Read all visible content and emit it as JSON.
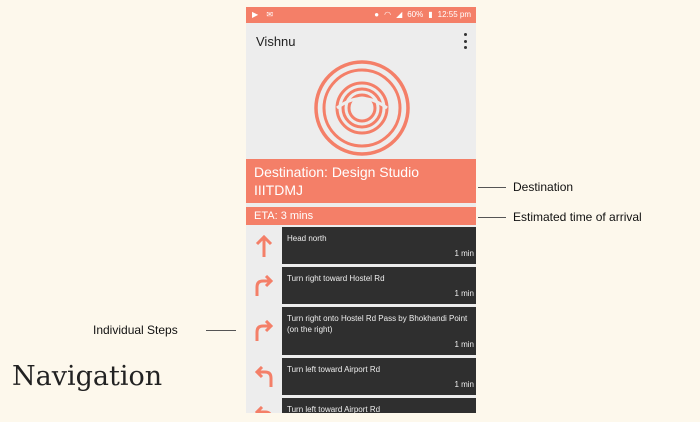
{
  "status_bar": {
    "left_icons": [
      "play-icon",
      "notification-icon"
    ],
    "battery": "60%",
    "time": "12:55 pm"
  },
  "app_bar": {
    "title": "Vishnu",
    "menu_icon": "more-vert-icon"
  },
  "destination": {
    "text": "Destination: Design Studio IIITDMJ"
  },
  "eta": {
    "text": "ETA: 3 mins"
  },
  "steps": [
    {
      "instruction": "Head north",
      "duration": "1 min",
      "icon": "arrow-up-icon"
    },
    {
      "instruction": "Turn right toward Hostel Rd",
      "duration": "1 min",
      "icon": "turn-right-icon"
    },
    {
      "instruction": "Turn right onto Hostel Rd Pass by Bhokhandi Point (on the right)",
      "duration": "1 min",
      "icon": "turn-right-icon"
    },
    {
      "instruction": "Turn left toward Airport Rd",
      "duration": "1 min",
      "icon": "turn-left-icon"
    },
    {
      "instruction": "Turn left toward Airport Rd",
      "duration": "",
      "icon": "turn-left-icon"
    }
  ],
  "annotations": {
    "destination": "Destination",
    "eta": "Estimated time of arrival",
    "steps": "Individual Steps"
  },
  "heading": "Navigation",
  "colors": {
    "accent": "#f47f68",
    "step_bg": "#2f2f2f",
    "page_bg": "#fdf8ec"
  }
}
